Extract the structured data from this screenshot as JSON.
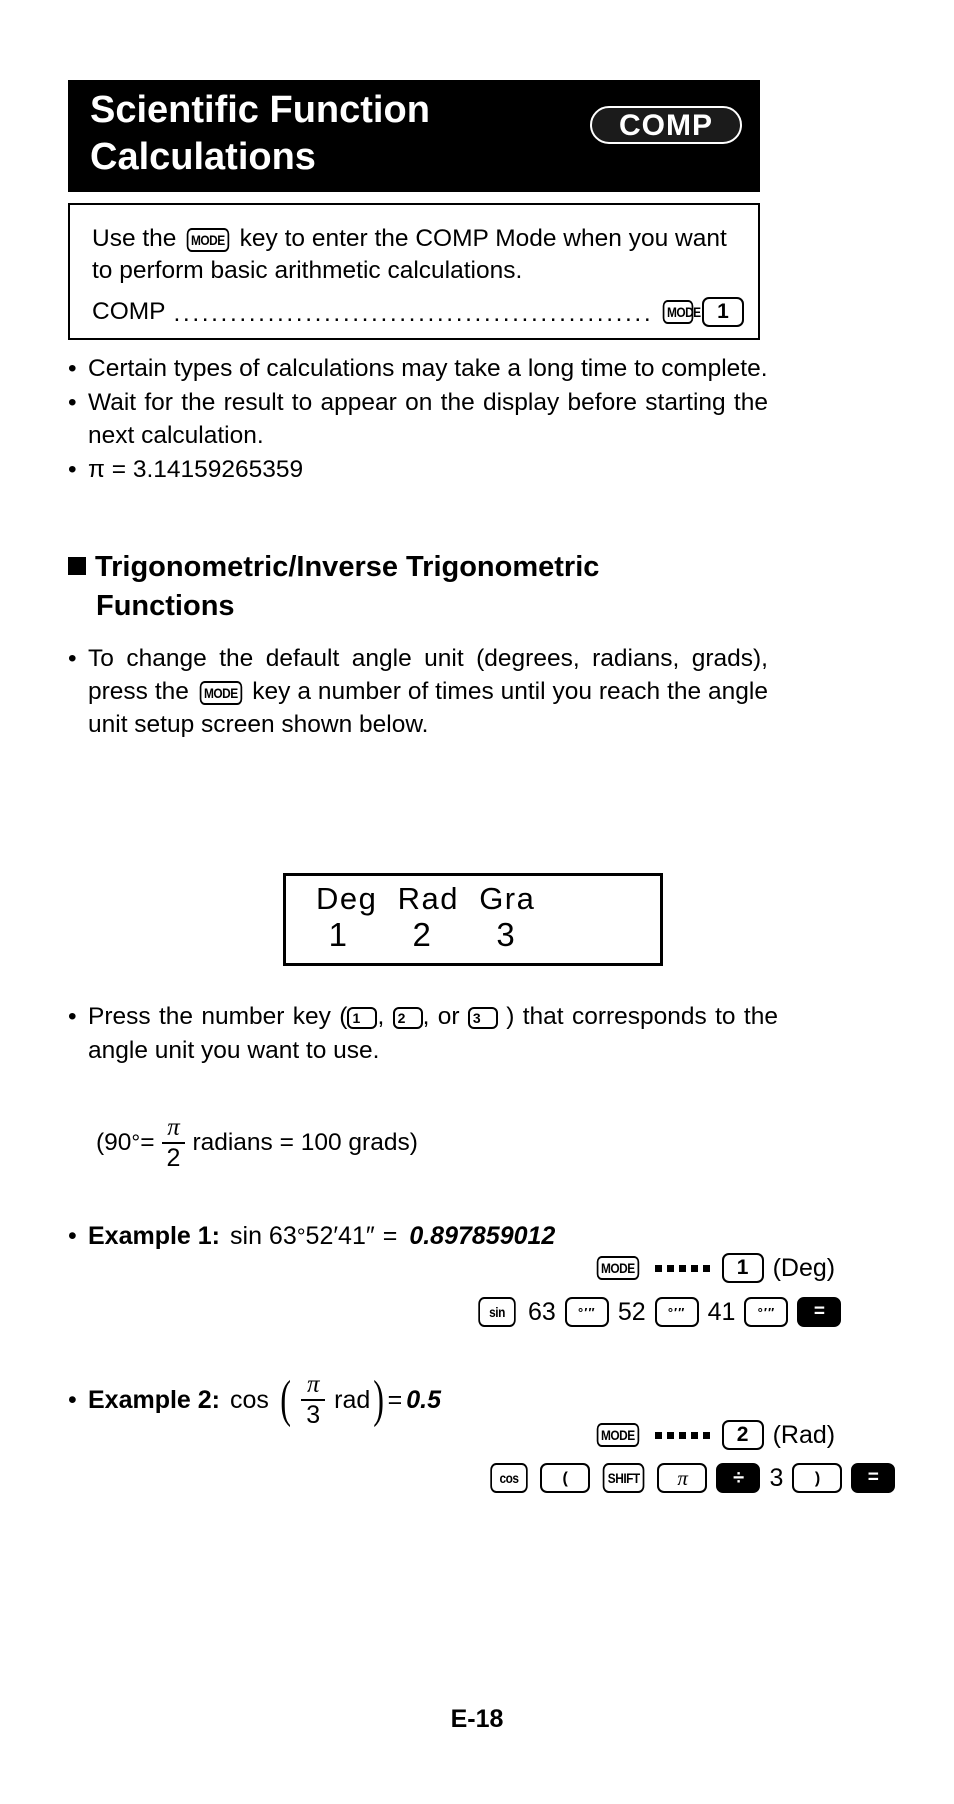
{
  "header": {
    "title": "Scientific Function\nCalculations",
    "badge": "COMP"
  },
  "intro_box": {
    "text_before_key": "Use the ",
    "mode_key": "MODE",
    "text_after_key": " key to enter the COMP Mode when you want to perform basic arithmetic calculations.",
    "mode_row": {
      "label": "COMP",
      "leader": "...........................................................................................",
      "key1": "MODE",
      "key2": "1"
    }
  },
  "bullets": [
    {
      "bullet": "•",
      "text": "Certain types of calculations may take a long time to complete."
    },
    {
      "bullet": "•",
      "text": "Wait for the result to appear on the display before starting the next calculation."
    },
    {
      "bullet": "•",
      "text": "π = 3.14159265359"
    }
  ],
  "section": {
    "line1": "Trigonometric/Inverse Trigonometric",
    "line2": "Functions"
  },
  "bullets2": [
    {
      "bullet": "•",
      "part1": "To change the default angle unit (degrees, radians, grads), press the ",
      "key": "MODE",
      "part2": " key a number of times until you reach the angle unit setup screen shown below."
    }
  ],
  "lcd": {
    "line1": "Deg  Rad  Gra",
    "line2": " 1      2      3"
  },
  "press_key_bullet": {
    "bullet": "•",
    "part1": "Press the number key (",
    "key1": "1",
    "sep1": ", ",
    "key2": "2",
    "sep2": ", or ",
    "key3": "3",
    "part2": " ) that corresponds to the angle unit you want to use."
  },
  "formula90": {
    "open": "(90",
    "degree": "°",
    "eq1": " = ",
    "frac_num": "π",
    "frac_den": "2",
    "mid": " radians = 100 grads)"
  },
  "example1": {
    "bullet": "•",
    "label": "Example 1:",
    "expression_fn": "sin 63",
    "degree": "°",
    "minutes": "52′",
    "seconds": "41″",
    "equals": "=",
    "result": "0.897859012",
    "mode_row": {
      "key_mode": "MODE",
      "key_num": "1",
      "note": "(Deg)"
    },
    "keys": [
      {
        "label": "sin",
        "style": "cond"
      },
      {
        "label": "63",
        "style": "plain"
      },
      {
        "label": "°′″",
        "style": "dms"
      },
      {
        "label": "52",
        "style": "plain"
      },
      {
        "label": "°′″",
        "style": "dms"
      },
      {
        "label": "41",
        "style": "plain"
      },
      {
        "label": "°′″",
        "style": "dms"
      },
      {
        "label": "=",
        "style": "inverted"
      }
    ]
  },
  "example2": {
    "bullet": "•",
    "label": "Example 2:",
    "expression_fn": "cos",
    "paren_open": "(",
    "frac_num": "π",
    "frac_den": "3",
    "rad": "rad",
    "paren_close": ")",
    "equals": "=",
    "result": "0.5",
    "mode_row": {
      "key_mode": "MODE",
      "key_num": "2",
      "note": "(Rad)"
    },
    "keys": [
      {
        "label": "cos",
        "style": "cond"
      },
      {
        "label": "(",
        "style": "plain"
      },
      {
        "label": "SHIFT",
        "style": "cond"
      },
      {
        "label": "π",
        "style": "pi"
      },
      {
        "label": "÷",
        "style": "inverted"
      },
      {
        "label": "3",
        "style": "bare"
      },
      {
        "label": ")",
        "style": "plain"
      },
      {
        "label": "=",
        "style": "inverted"
      }
    ]
  },
  "footer": {
    "page": "E-18"
  }
}
